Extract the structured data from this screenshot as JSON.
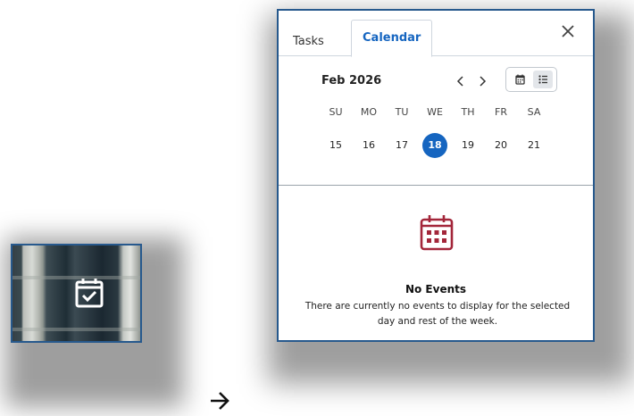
{
  "tabs": [
    {
      "label": "Tasks",
      "active": false
    },
    {
      "label": "Calendar",
      "active": true
    }
  ],
  "calendar": {
    "month_label": "Feb 2026",
    "weekdays": [
      "SU",
      "MO",
      "TU",
      "WE",
      "TH",
      "FR",
      "SA"
    ],
    "dates": [
      "15",
      "16",
      "17",
      "18",
      "19",
      "20",
      "21"
    ],
    "selected_date": "18",
    "view_mode": "list"
  },
  "empty_state": {
    "title": "No Events",
    "message": "There are currently no events to display for the selected day and rest of the week."
  },
  "icons": {
    "thumbnail": "calendar-check-icon",
    "close": "close-icon",
    "prev": "chevron-left-icon",
    "next": "chevron-right-icon",
    "calendar_view": "calendar-view-icon",
    "list_view": "list-view-icon",
    "empty": "calendar-grid-icon",
    "arrow": "arrow-right-icon"
  },
  "colors": {
    "accent": "#1565c0",
    "border": "#27598d",
    "empty_icon": "#a3263a"
  }
}
